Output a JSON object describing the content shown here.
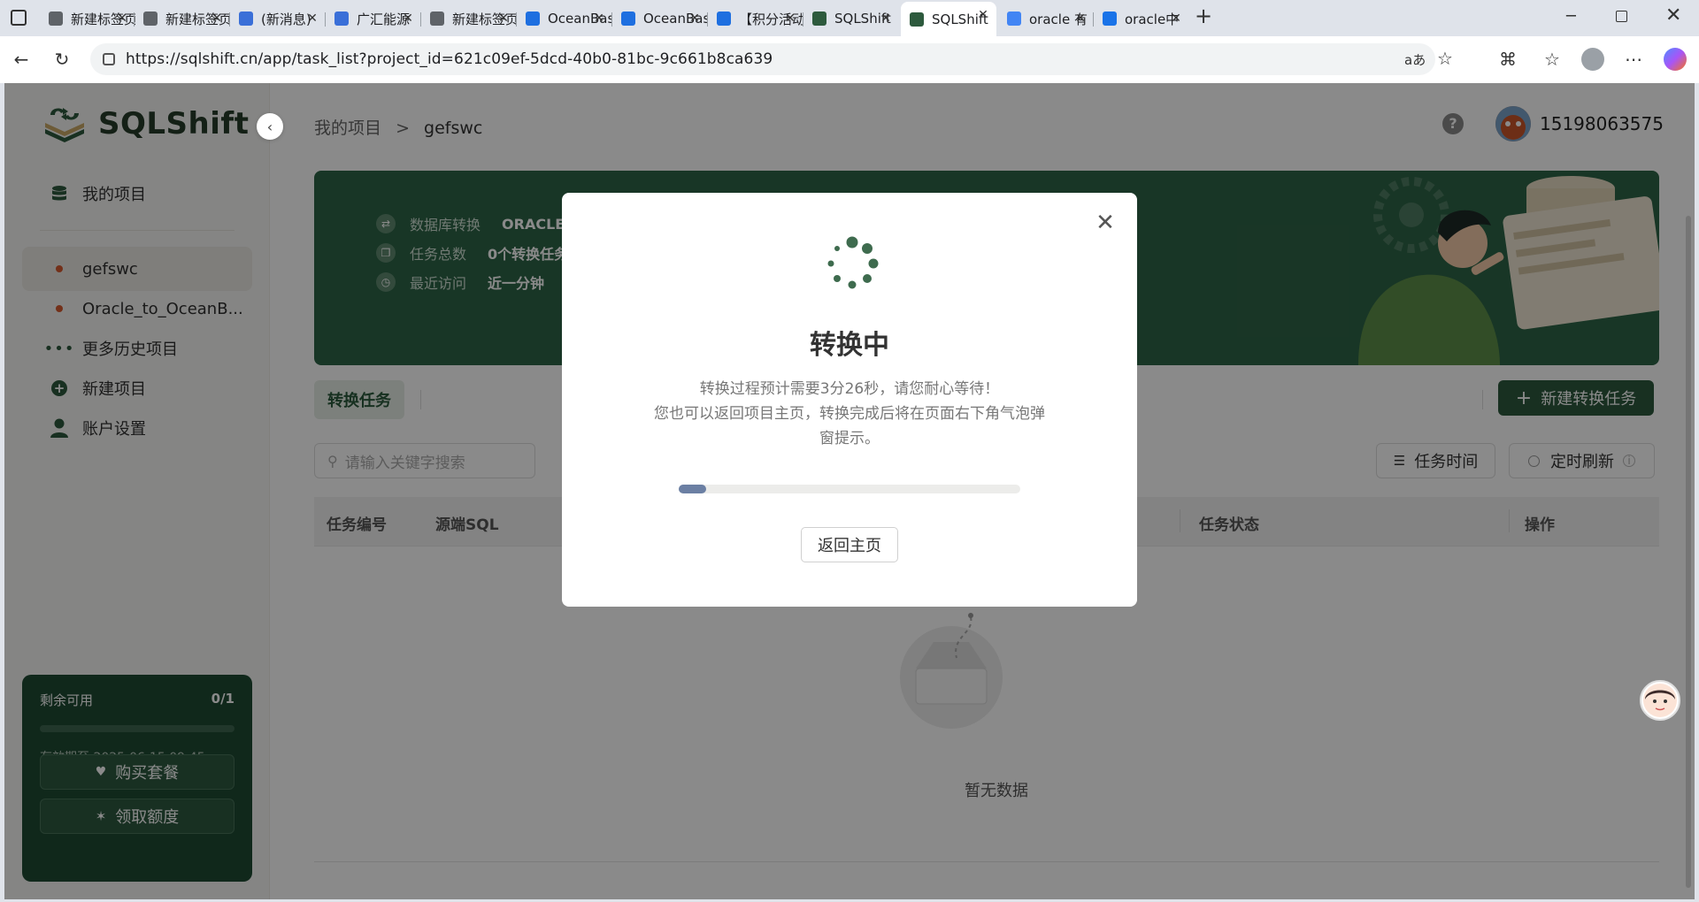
{
  "browser": {
    "tabs": [
      {
        "title": "新建标签页",
        "favicon": "page-icon",
        "color": "#5f6368"
      },
      {
        "title": "新建标签页",
        "favicon": "page-icon",
        "color": "#5f6368"
      },
      {
        "title": "(新消息)",
        "favicon": "swirl-icon",
        "color": "#3a6fd8"
      },
      {
        "title": "广汇能源",
        "favicon": "swirl-icon",
        "color": "#3a6fd8"
      },
      {
        "title": "新建标签页",
        "favicon": "page-icon",
        "color": "#5f6368"
      },
      {
        "title": "OceanBase",
        "favicon": "oceanbase-icon",
        "color": "#1e6fe0"
      },
      {
        "title": "OceanBase",
        "favicon": "oceanbase-icon",
        "color": "#1e6fe0"
      },
      {
        "title": "【积分活动】",
        "favicon": "oceanbase-icon",
        "color": "#1e6fe0"
      },
      {
        "title": "SQLShift",
        "favicon": "sqlshift-icon",
        "color": "#2d5a3d"
      },
      {
        "title": "SQLShift",
        "favicon": "sqlshift-icon",
        "color": "#2d5a3d"
      },
      {
        "title": "oracle 有",
        "favicon": "google-icon",
        "color": "#4285f4"
      },
      {
        "title": "oracle中",
        "favicon": "globe-icon",
        "color": "#1a73e8"
      }
    ],
    "url": "https://sqlshift.cn/app/task_list?project_id=621c09ef-5dcd-40b0-81bc-9c661b8ca639"
  },
  "app": {
    "logo_text": "SQLShift",
    "breadcrumb": {
      "parent": "我的项目",
      "separator": ">",
      "current": "gefswc"
    },
    "user": {
      "phone": "15198063575"
    },
    "sidebar": {
      "items": [
        {
          "label": "我的项目",
          "icon": "database-icon"
        },
        {
          "label": "gefswc",
          "icon": "dot-icon"
        },
        {
          "label": "Oracle_to_OceanB...",
          "icon": "dot-icon"
        },
        {
          "label": "更多历史项目",
          "icon": "more-icon"
        },
        {
          "label": "新建项目",
          "icon": "plus-circle-icon"
        },
        {
          "label": "账户设置",
          "icon": "user-icon"
        }
      ]
    },
    "quota": {
      "label": "剩余可用",
      "count": "0/1",
      "expiry": "有效期至 2025-06-15 09:45",
      "buy_label": "购买套餐",
      "claim_label": "领取额度"
    },
    "banner": {
      "rows": [
        {
          "label": "数据库转换",
          "value": "ORACLE →"
        },
        {
          "label": "任务总数",
          "value": "0个转换任务"
        },
        {
          "label": "最近访问",
          "value": "近一分钟"
        }
      ]
    },
    "tasks_tab": "转换任务",
    "new_task_label": "新建转换任务",
    "search_placeholder": "请输入关键字搜索",
    "filter_time": "任务时间",
    "filter_refresh": "定时刷新",
    "table_headers": [
      "任务编号",
      "源端SQL",
      "任务状态",
      "操作"
    ],
    "empty_text": "暂无数据"
  },
  "modal": {
    "title": "转换中",
    "line1": "转换过程预计需要3分26秒，请您耐心等待！",
    "line2": "您也可以返回项目主页，转换完成后将在页面右下角气泡弹窗提示。",
    "progress": 0.08,
    "back_label": "返回主页"
  },
  "colors": {
    "brand": "#2d5a3d",
    "progress": "#6b7fa3"
  }
}
